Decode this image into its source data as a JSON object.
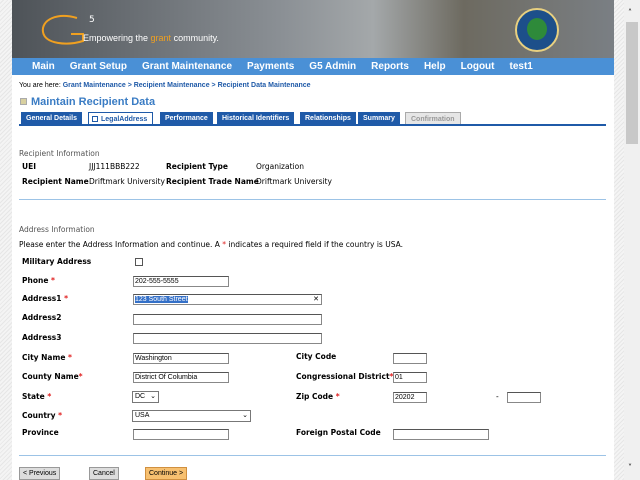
{
  "banner": {
    "logo": "G5",
    "tagline_pre": "Empowering the ",
    "tagline_accent": "grant",
    "tagline_post": " community.",
    "seal": "Department of Education seal"
  },
  "nav": [
    "Main",
    "Grant Setup",
    "Grant Maintenance",
    "Payments",
    "G5 Admin",
    "Reports",
    "Help",
    "Logout",
    "test1"
  ],
  "breadcrumb": {
    "prefix": "You are here:",
    "items": [
      "Grant Maintenance",
      "Recipient Maintenance",
      "Recipient Data Maintenance"
    ],
    "sep": " > "
  },
  "title": "Maintain Recipient Data",
  "tabs": [
    "General Details",
    "LegalAddress",
    "Performance",
    "Historical Identifiers",
    "Relationships",
    "Summary",
    "Confirmation"
  ],
  "recipient": {
    "heading": "Recipient Information",
    "uei_label": "UEI",
    "uei": "JJJ111BBB222",
    "type_label": "Recipient Type",
    "type": "Organization",
    "name_label": "Recipient Name",
    "name": "Driftmark University",
    "trade_label": "Recipient Trade Name",
    "trade": "Driftmark University"
  },
  "address": {
    "heading": "Address Information",
    "instr_pre": "Please enter the Address Information and continue. A ",
    "instr_star": "*",
    "instr_post": " indicates a required field if the country is USA.",
    "military_label": "Military Address",
    "phone_label": "Phone",
    "phone": "202-555-5555",
    "address1_label": "Address1",
    "address1": "123 South Street",
    "address2_label": "Address2",
    "address3_label": "Address3",
    "city_label": "City Name",
    "city": "Washington",
    "county_label": "County Name",
    "county": "District Of Columbia",
    "state_label": "State",
    "state": "DC",
    "country_label": "Country",
    "country": "USA",
    "province_label": "Province",
    "citycode_label": "City Code",
    "district_label": "Congressional District",
    "district": "01",
    "zip_label": "Zip Code",
    "zip": "20202",
    "zip_dash": "-",
    "postal_label": "Foreign Postal Code",
    "required_star": "*"
  },
  "buttons": {
    "previous": "< Previous",
    "cancel": "Cancel",
    "continue": "Continue >"
  },
  "colors": {
    "nav": "#4a90d6",
    "tab": "#1f5aa8",
    "accent": "#f0a020",
    "required": "#e02020"
  }
}
